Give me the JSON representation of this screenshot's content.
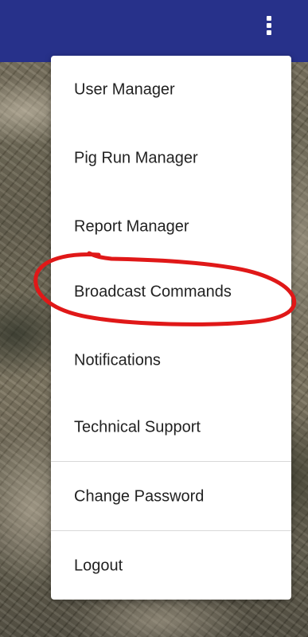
{
  "header": {
    "menu_icon": "more-vertical-icon",
    "color": "#27318a"
  },
  "menu": {
    "items": [
      {
        "label": "User Manager"
      },
      {
        "label": "Pig Run Manager"
      },
      {
        "label": "Report Manager"
      },
      {
        "label": "Broadcast Commands"
      },
      {
        "label": "Notifications"
      },
      {
        "label": "Technical Support"
      },
      {
        "label": "Change Password"
      },
      {
        "label": "Logout"
      }
    ]
  },
  "annotation": {
    "color": "#e01818",
    "highlighted_item": "Broadcast Commands"
  }
}
